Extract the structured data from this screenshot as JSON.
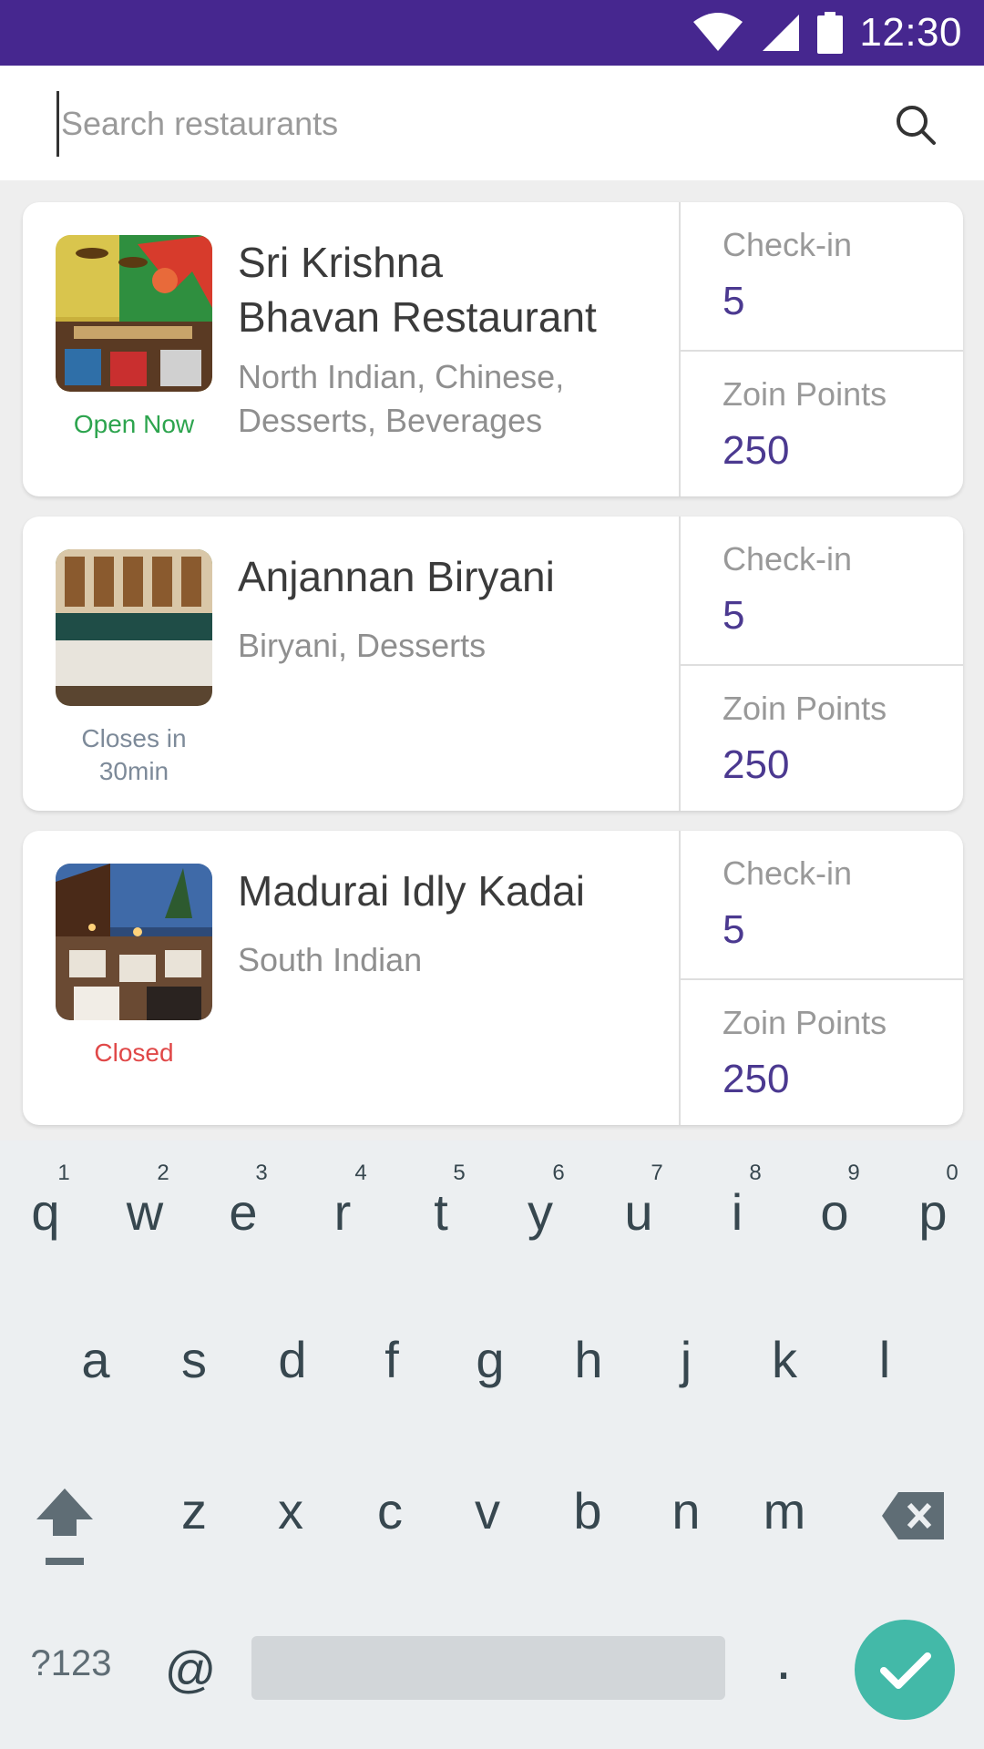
{
  "status_bar": {
    "time": "12:30",
    "icons": [
      "wifi-icon",
      "signal-icon",
      "battery-icon"
    ]
  },
  "search": {
    "placeholder": "Search restaurants",
    "value": ""
  },
  "restaurants": [
    {
      "name_line1": "Sri Krishna",
      "name_line2": "Bhavan Restaurant",
      "cuisine_line1": "North Indian, Chinese,",
      "cuisine_line2": "Desserts, Beverages",
      "status_line1": "Open Now",
      "status_line2": "",
      "status_color": "#2da44e",
      "checkin_label": "Check-in",
      "checkin_value": "5",
      "points_label": "Zoin Points",
      "points_value": "250"
    },
    {
      "name_line1": "Anjannan Biryani",
      "name_line2": "",
      "cuisine_line1": "Biryani, Desserts",
      "cuisine_line2": "",
      "status_line1": "Closes in",
      "status_line2": "30min",
      "status_color": "#7d8a99",
      "checkin_label": "Check-in",
      "checkin_value": "5",
      "points_label": "Zoin Points",
      "points_value": "250"
    },
    {
      "name_line1": "Madurai Idly Kadai",
      "name_line2": "",
      "cuisine_line1": "South Indian",
      "cuisine_line2": "",
      "status_line1": "Closed",
      "status_line2": "",
      "status_color": "#e04848",
      "checkin_label": "Check-in",
      "checkin_value": "5",
      "points_label": "Zoin Points",
      "points_value": "250"
    }
  ],
  "keyboard": {
    "numbers": [
      "1",
      "2",
      "3",
      "4",
      "5",
      "6",
      "7",
      "8",
      "9",
      "0"
    ],
    "row1": [
      "q",
      "w",
      "e",
      "r",
      "t",
      "y",
      "u",
      "i",
      "o",
      "p"
    ],
    "row2": [
      "a",
      "s",
      "d",
      "f",
      "g",
      "h",
      "j",
      "k",
      "l"
    ],
    "row3": [
      "z",
      "x",
      "c",
      "v",
      "b",
      "n",
      "m"
    ],
    "symbols_label": "?123",
    "at_label": "@",
    "period_label": "."
  },
  "colors": {
    "accent": "#46278f",
    "value": "#4b3990",
    "enter": "#43b9a8"
  }
}
